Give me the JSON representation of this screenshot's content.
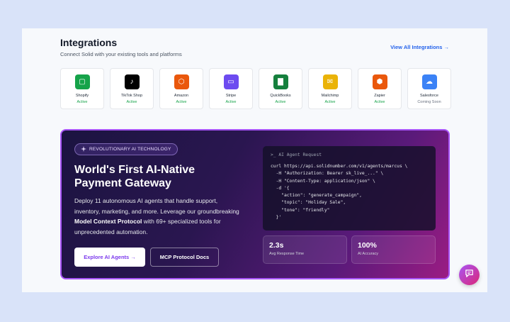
{
  "integrations": {
    "title": "Integrations",
    "subtitle": "Connect Solid with your existing tools and platforms",
    "view_all": "View All Integrations →",
    "items": [
      {
        "name": "Shopify",
        "status": "Active",
        "color": "#16a34a",
        "icon": "shopping-bag-icon",
        "glyph": "▢"
      },
      {
        "name": "TikTok Shop",
        "status": "Active",
        "color": "#000000",
        "icon": "music-note-icon",
        "glyph": "♪"
      },
      {
        "name": "Amazon",
        "status": "Active",
        "color": "#ea580c",
        "icon": "box-icon",
        "glyph": "⬡"
      },
      {
        "name": "Stripe",
        "status": "Active",
        "color": "#6d4bf0",
        "icon": "credit-card-icon",
        "glyph": "▭"
      },
      {
        "name": "QuickBooks",
        "status": "Active",
        "color": "#15803d",
        "icon": "bar-chart-icon",
        "glyph": "▇"
      },
      {
        "name": "Mailchimp",
        "status": "Active",
        "color": "#eab308",
        "icon": "mail-icon",
        "glyph": "✉"
      },
      {
        "name": "Zapier",
        "status": "Active",
        "color": "#ea580c",
        "icon": "zap-icon",
        "glyph": "⬢"
      },
      {
        "name": "Salesforce",
        "status": "Coming Soon",
        "color": "#3b82f6",
        "icon": "cloud-icon",
        "glyph": "☁"
      }
    ]
  },
  "hero": {
    "badge": "REVOLUTIONARY AI TECHNOLOGY",
    "title": "World's First AI-Native Payment Gateway",
    "body_before": "Deploy 11 autonomous AI agents that handle support, inventory, marketing, and more. Leverage our groundbreaking ",
    "body_bold": "Model Context Protocol",
    "body_after": " with 69+ specialized tools for unprecedented automation.",
    "primary_button": "Explore AI Agents →",
    "secondary_button": "MCP Protocol Docs",
    "code_header": ">_ AI Agent Request",
    "code_lines": [
      "curl https://api.solidnumber.com/v1/agents/marcus \\",
      "  -H \"Authorization: Bearer sk_live_...\" \\",
      "  -H \"Content-Type: application/json\" \\",
      "  -d '{",
      "    \"action\": \"generate_campaign\",",
      "    \"topic\": \"Holiday Sale\",",
      "    \"tone\": \"friendly\"",
      "  }'"
    ],
    "stats": [
      {
        "value": "2.3s",
        "label": "Avg Response Time"
      },
      {
        "value": "100%",
        "label": "AI Accuracy"
      }
    ]
  }
}
